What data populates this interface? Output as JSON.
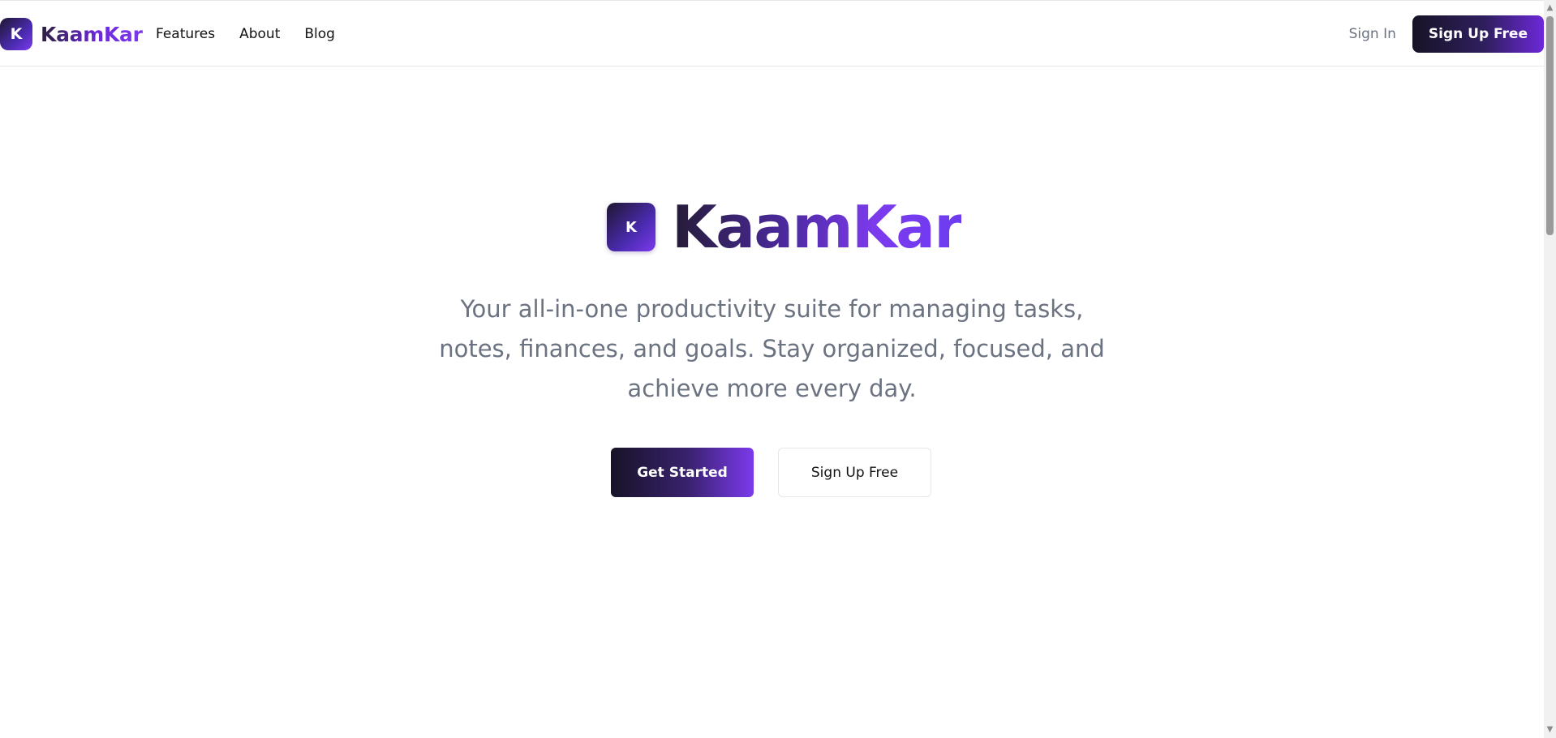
{
  "header": {
    "brand": {
      "logo_letter": "K",
      "name": "KaamKar"
    },
    "nav": [
      {
        "label": "Features"
      },
      {
        "label": "About"
      },
      {
        "label": "Blog"
      }
    ],
    "sign_in_label": "Sign In",
    "sign_up_label": "Sign Up Free"
  },
  "hero": {
    "logo_letter": "K",
    "title": "KaamKar",
    "description": "Your all-in-one productivity suite for managing tasks, notes, finances, and goals. Stay organized, focused, and achieve more every day.",
    "primary_cta": "Get Started",
    "secondary_cta": "Sign Up Free"
  },
  "scrollbar": {
    "up_icon": "chevron-up-icon",
    "down_icon": "chevron-down-icon"
  },
  "colors": {
    "brand_dark": "#171327",
    "brand_purple": "#7c3aed",
    "text_muted": "#6b7280",
    "border": "#e5e7eb"
  }
}
